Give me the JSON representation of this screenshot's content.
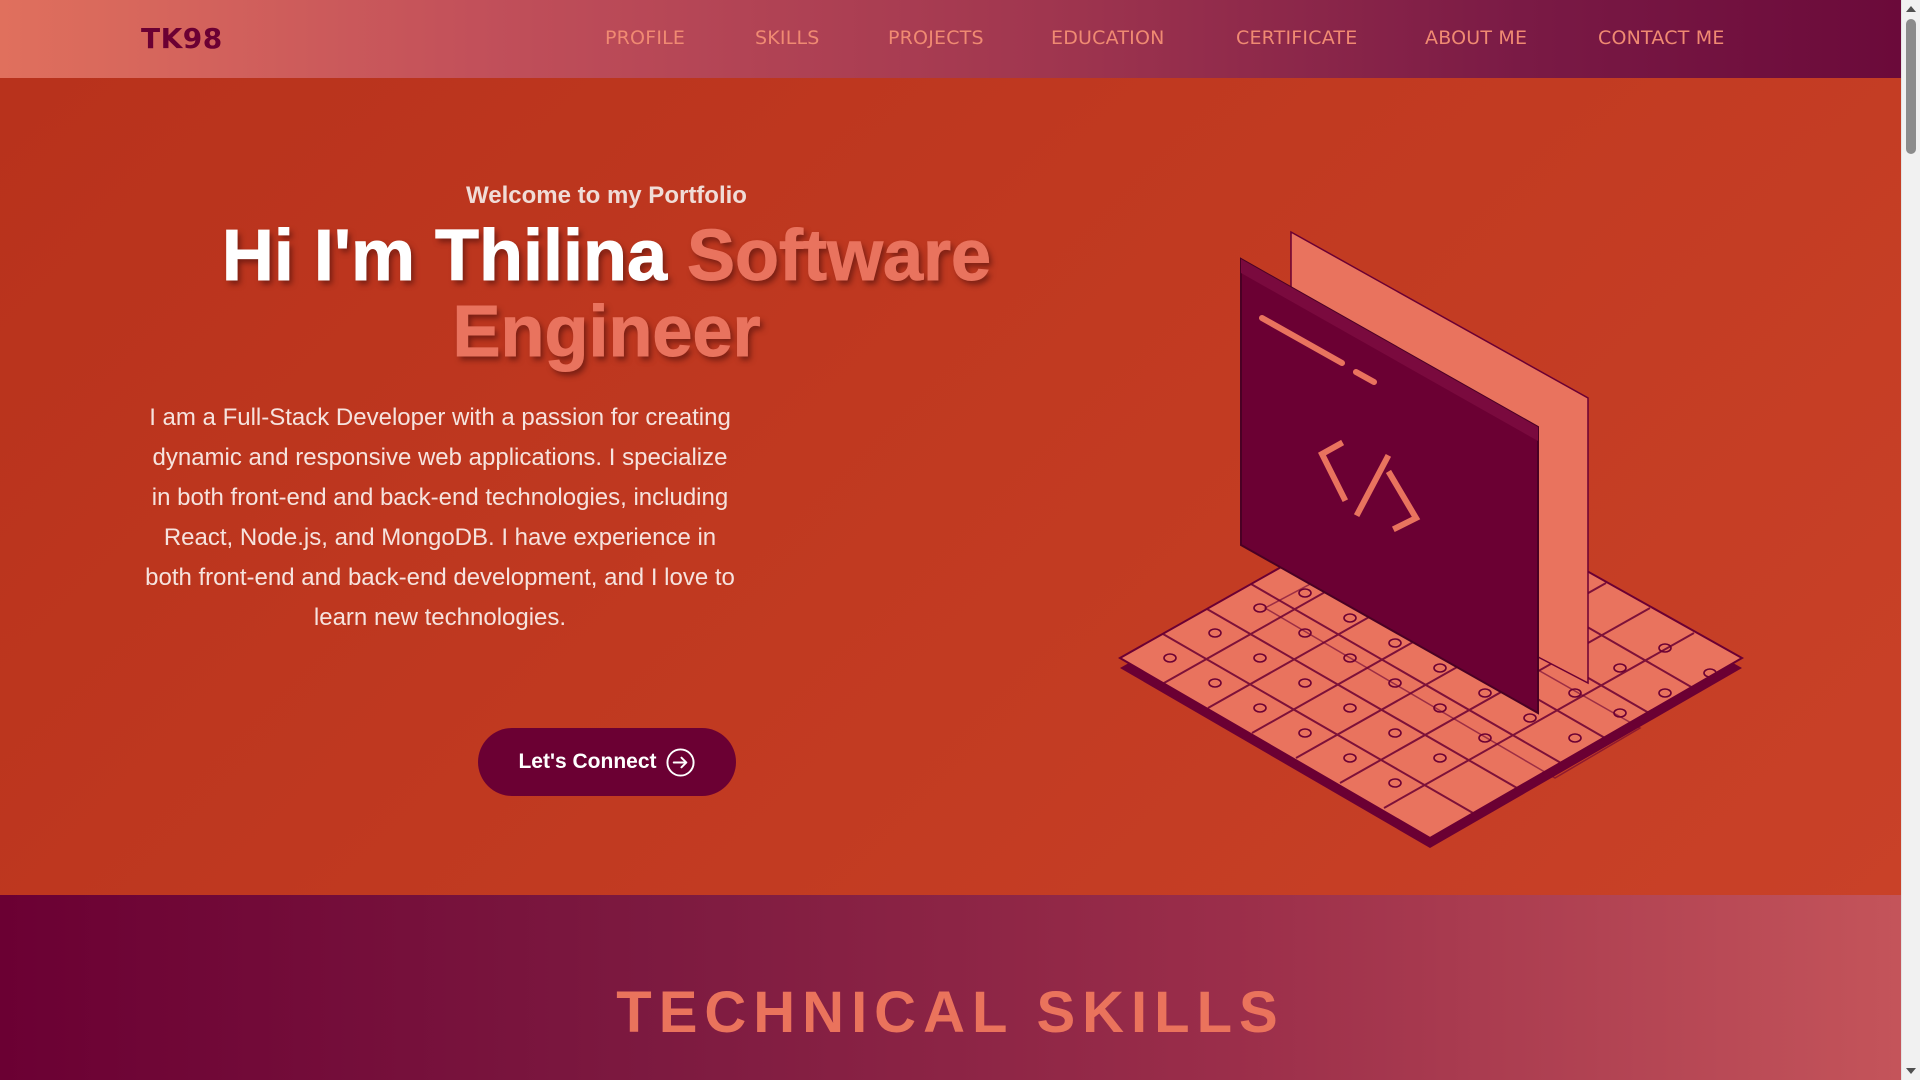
{
  "nav": {
    "brand": "TK98",
    "links": [
      {
        "label": "PROFILE"
      },
      {
        "label": "SKILLS"
      },
      {
        "label": "PROJECTS"
      },
      {
        "label": "EDUCATION"
      },
      {
        "label": "CERTIFICATE"
      },
      {
        "label": "ABOUT ME"
      },
      {
        "label": "CONTACT ME"
      }
    ]
  },
  "hero": {
    "welcome": "Welcome to my Portfolio",
    "headline_intro": "Hi I'm Thilina ",
    "headline_role": "Software Engineer",
    "bio": "I am a Full-Stack Developer with a passion for creating dynamic and responsive web applications. I specialize in both front-end and back-end technologies, including React, Node.js, and MongoDB. I have experience in both front-end and back-end development, and I love to learn new technologies.",
    "cta_label": "Let's Connect",
    "cta_icon": "arrow-right-circle-icon",
    "illustration_icon": "code-laptop-illustration",
    "code_glyph": "</>"
  },
  "skills": {
    "title": "TECHNICAL SKILLS"
  },
  "colors": {
    "primary_dark": "#6b0033",
    "hero_bg": "#c13a21",
    "accent": "#e9735e",
    "nav_link": "#f08a72"
  }
}
